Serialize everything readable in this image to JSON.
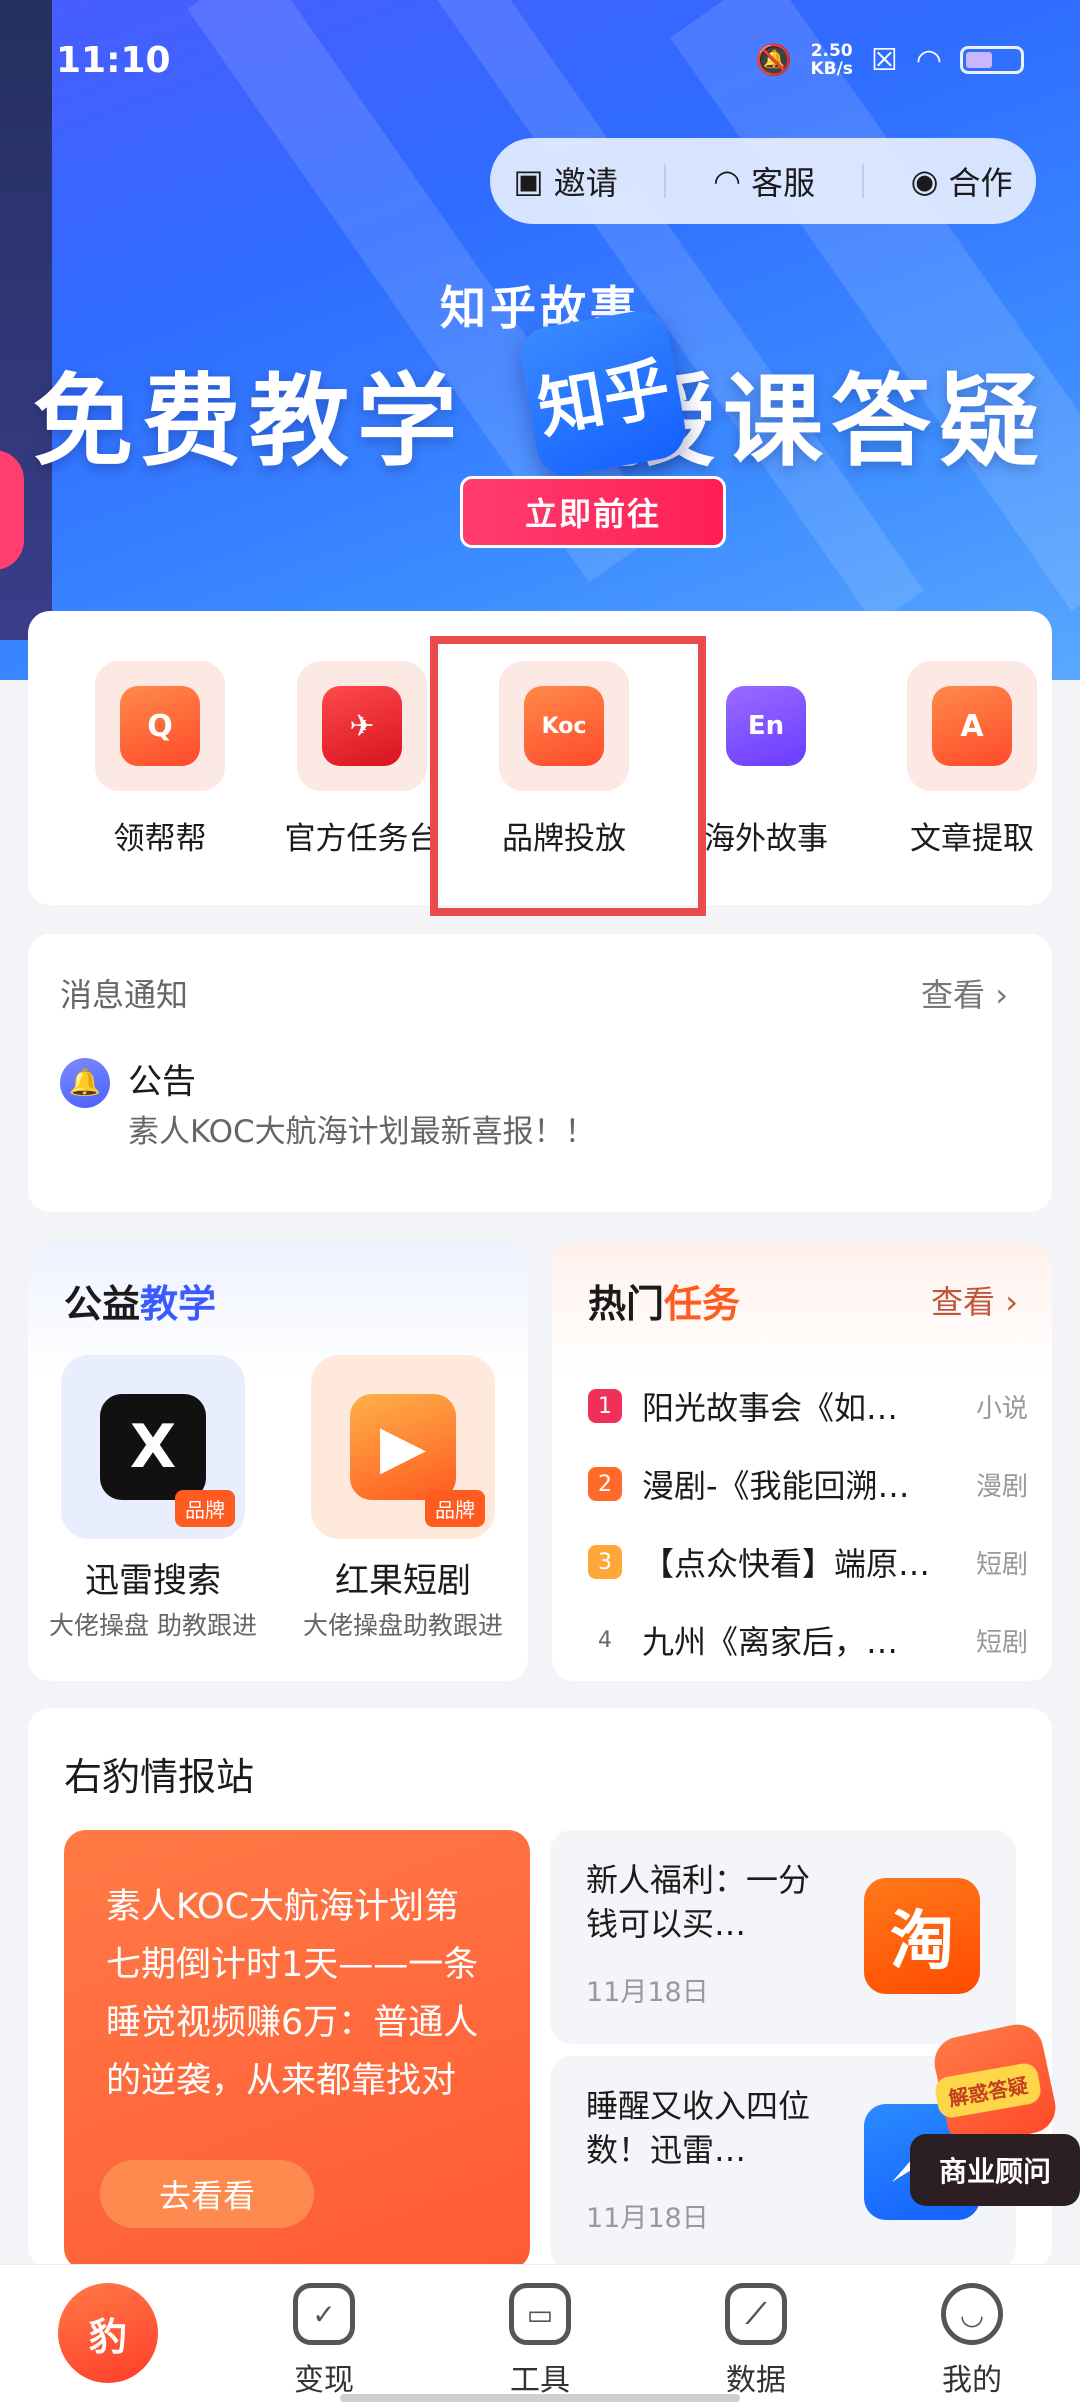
{
  "status_bar": {
    "time": "11:10",
    "speed_value": "2.50",
    "speed_unit": "KB/s"
  },
  "header_actions": [
    {
      "label": "邀请",
      "icon": "invite-icon"
    },
    {
      "label": "客服",
      "icon": "headset-icon"
    },
    {
      "label": "合作",
      "icon": "handshake-icon"
    }
  ],
  "banner": {
    "subtitle": "知乎故事",
    "title_left": "免费教学",
    "title_right": "授课答疑",
    "badge": "知乎",
    "button": "立即前往"
  },
  "tools": [
    {
      "label": "领帮帮",
      "glyph": "Q"
    },
    {
      "label": "官方任务台",
      "glyph": "✈"
    },
    {
      "label": "品牌投放",
      "glyph": "Koc"
    },
    {
      "label": "海外故事",
      "glyph": "En"
    },
    {
      "label": "文章提取",
      "glyph": "A"
    }
  ],
  "notice": {
    "title": "消息通知",
    "more": "查看",
    "headline": "公告",
    "detail": "素人KOC大航海计划最新喜报！！"
  },
  "public_teaching": {
    "title_plain": "公益",
    "title_accent": "教学",
    "apps": [
      {
        "name": "迅雷搜索",
        "sub": "大佬操盘 助教跟进",
        "tag": "品牌",
        "glyph": "X"
      },
      {
        "name": "红果短剧",
        "sub": "大佬操盘助教跟进",
        "tag": "品牌",
        "glyph": "▶"
      }
    ]
  },
  "hot_tasks": {
    "title_plain": "热门",
    "title_accent": "任务",
    "more": "查看",
    "items": [
      {
        "rank": "1",
        "text": "阳光故事会《如…",
        "category": "小说"
      },
      {
        "rank": "2",
        "text": "漫剧-《我能回溯…",
        "category": "漫剧"
      },
      {
        "rank": "3",
        "text": "【点众快看】端原…",
        "category": "短剧"
      },
      {
        "rank": "4",
        "text": "九州《离家后，…",
        "category": "短剧"
      }
    ]
  },
  "intel_station": {
    "title": "右豹情报站",
    "feature_text": "素人KOC大航海计划第七期倒计时1天——一条睡觉视频赚6万：普通人的逆袭，从来都靠找对",
    "feature_button": "去看看",
    "news": [
      {
        "title": "新人福利：一分钱可以买…",
        "date": "11月18日",
        "thumb": "淘"
      },
      {
        "title": "睡醒又收入四位数！迅雷…",
        "date": "11月18日",
        "thumb": ""
      }
    ]
  },
  "floating_consultant": {
    "badge": "解惑答疑",
    "label": "商业顾问"
  },
  "tabbar": {
    "items": [
      {
        "label": "",
        "icon": "home-logo-icon"
      },
      {
        "label": "变现",
        "icon": "check-shield-icon"
      },
      {
        "label": "工具",
        "icon": "briefcase-icon"
      },
      {
        "label": "数据",
        "icon": "chart-monitor-icon"
      },
      {
        "label": "我的",
        "icon": "smile-icon"
      }
    ]
  }
}
